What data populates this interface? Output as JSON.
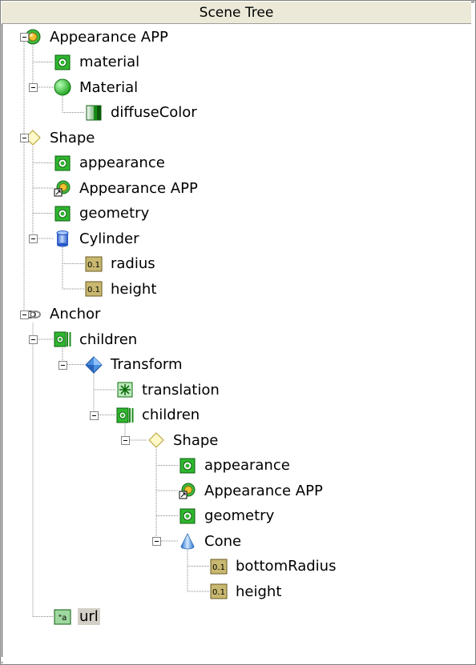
{
  "panel": {
    "title": "Scene Tree"
  },
  "nodes": [
    {
      "label": "Appearance APP",
      "icon": "appearance-icon",
      "depth": 0,
      "expandable": true
    },
    {
      "label": "material",
      "icon": "field-sfnode-icon",
      "depth": 1,
      "expandable": false
    },
    {
      "label": "Material",
      "icon": "material-icon",
      "depth": 1,
      "expandable": true
    },
    {
      "label": "diffuseColor",
      "icon": "color-field-icon",
      "depth": 2,
      "expandable": false
    },
    {
      "label": "Shape",
      "icon": "shape-icon",
      "depth": 0,
      "expandable": true
    },
    {
      "label": "appearance",
      "icon": "field-sfnode-icon",
      "depth": 1,
      "expandable": false
    },
    {
      "label": "Appearance APP",
      "icon": "appearance-use-icon",
      "depth": 1,
      "expandable": false
    },
    {
      "label": "geometry",
      "icon": "field-sfnode-icon",
      "depth": 1,
      "expandable": false
    },
    {
      "label": "Cylinder",
      "icon": "cylinder-icon",
      "depth": 1,
      "expandable": true
    },
    {
      "label": "radius",
      "icon": "float-field-icon",
      "depth": 2,
      "expandable": false
    },
    {
      "label": "height",
      "icon": "float-field-icon",
      "depth": 2,
      "expandable": false
    },
    {
      "label": "Anchor",
      "icon": "anchor-icon",
      "depth": 0,
      "expandable": true
    },
    {
      "label": "children",
      "icon": "field-mfnode-icon",
      "depth": 1,
      "expandable": true
    },
    {
      "label": "Transform",
      "icon": "transform-icon",
      "depth": 2,
      "expandable": true
    },
    {
      "label": "translation",
      "icon": "vector-field-icon",
      "depth": 3,
      "expandable": false
    },
    {
      "label": "children",
      "icon": "field-mfnode-icon",
      "depth": 3,
      "expandable": true
    },
    {
      "label": "Shape",
      "icon": "shape-icon",
      "depth": 4,
      "expandable": true
    },
    {
      "label": "appearance",
      "icon": "field-sfnode-icon",
      "depth": 5,
      "expandable": false
    },
    {
      "label": "Appearance APP",
      "icon": "appearance-use-icon",
      "depth": 5,
      "expandable": false
    },
    {
      "label": "geometry",
      "icon": "field-sfnode-icon",
      "depth": 5,
      "expandable": false
    },
    {
      "label": "Cone",
      "icon": "cone-icon",
      "depth": 5,
      "expandable": true
    },
    {
      "label": "bottomRadius",
      "icon": "float-field-icon",
      "depth": 6,
      "expandable": false
    },
    {
      "label": "height",
      "icon": "float-field-icon",
      "depth": 6,
      "expandable": false
    },
    {
      "label": "url",
      "icon": "string-field-icon",
      "depth": 1,
      "expandable": false,
      "selected": true
    }
  ],
  "float_badge": "0.1",
  "string_badge": "\"a"
}
